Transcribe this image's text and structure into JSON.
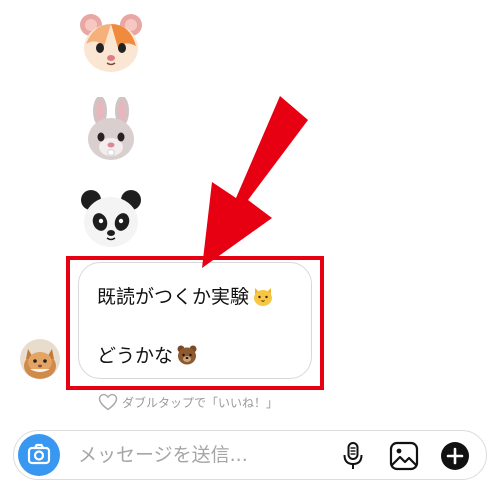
{
  "conversation": {
    "stickers": [
      {
        "name": "hamster",
        "icon": "hamster-face-icon"
      },
      {
        "name": "rabbit",
        "icon": "rabbit-face-icon"
      },
      {
        "name": "panda",
        "icon": "panda-face-icon"
      }
    ],
    "message": {
      "line1": "既読がつくか実験",
      "line1_emoji": "cat-face-icon",
      "line2": "どうかな",
      "line2_emoji": "bear-face-icon"
    },
    "like_hint": "ダブルタップで「いいね！」"
  },
  "annotation": {
    "color": "#e60012",
    "arrow": "red-arrow-icon",
    "box": "red-highlight-box"
  },
  "composer": {
    "placeholder": "メッセージを送信...",
    "camera_icon": "camera-icon",
    "mic_icon": "microphone-icon",
    "gallery_icon": "image-gallery-icon",
    "add_icon": "plus-circle-icon",
    "accent": "#3897f0"
  }
}
